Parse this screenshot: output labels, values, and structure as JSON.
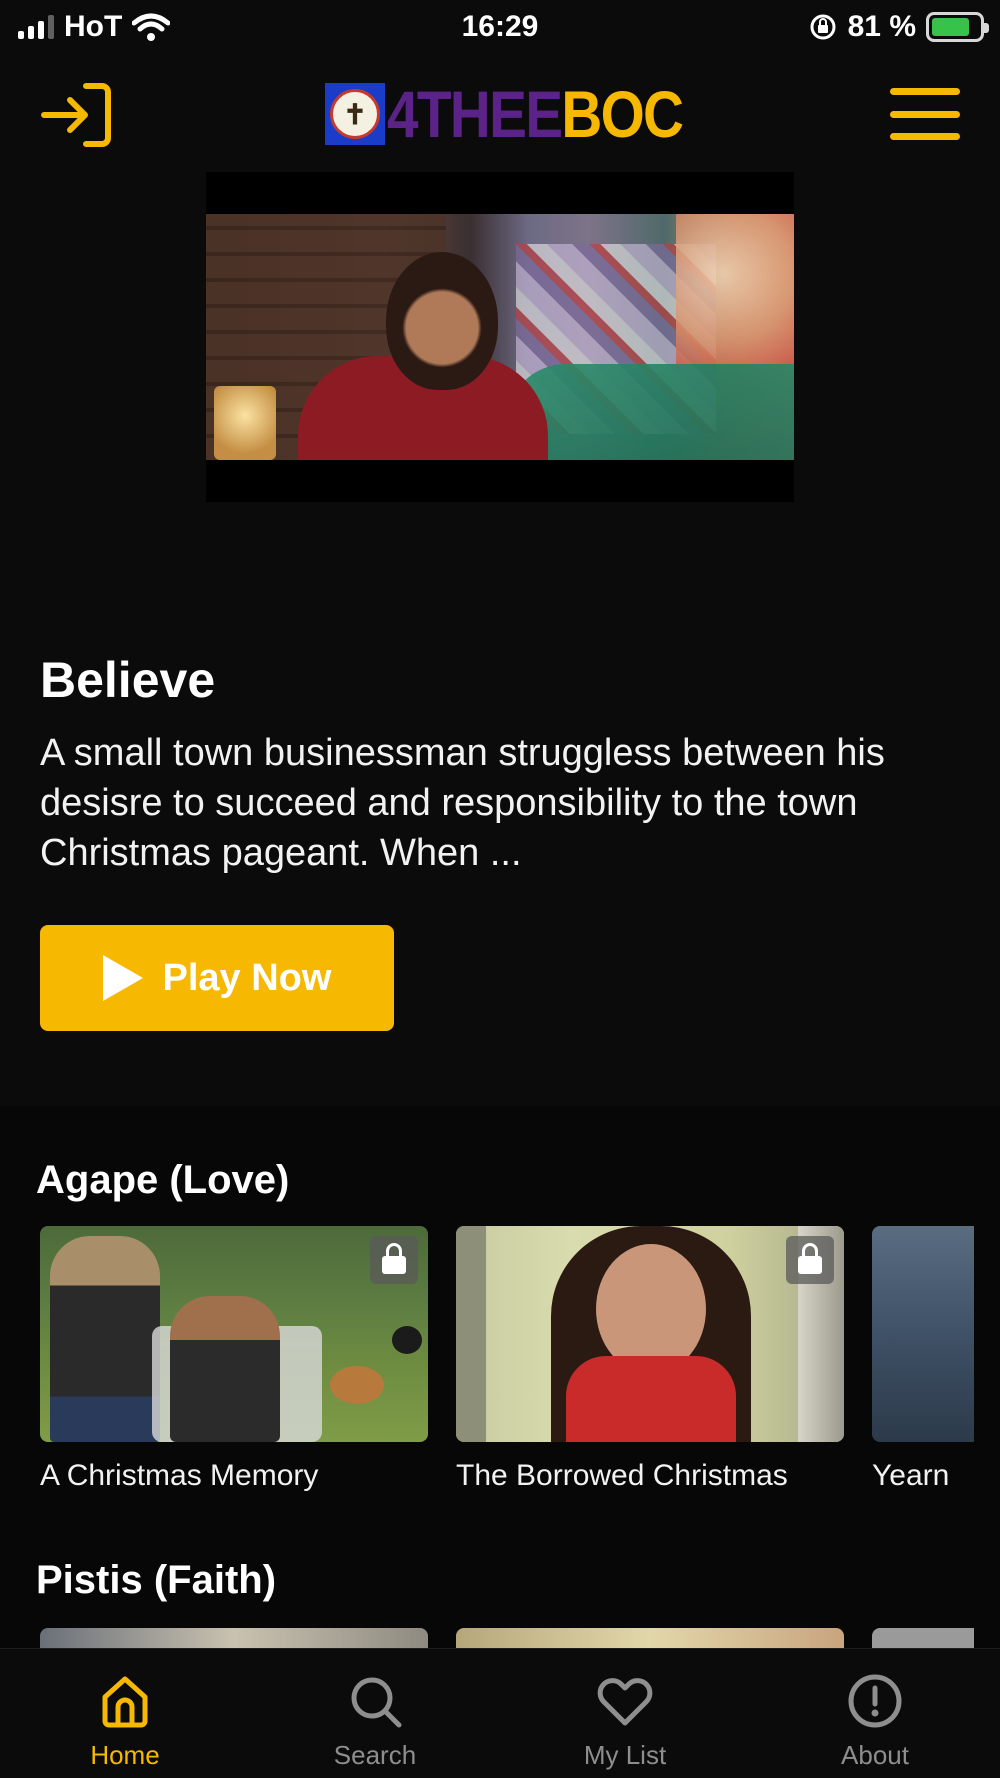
{
  "status_bar": {
    "carrier": "HoT",
    "time": "16:29",
    "battery_percent": "81 %",
    "battery_level": 0.81
  },
  "header": {
    "logo_part1": "4THEE",
    "logo_part2": "BOC",
    "login_icon": "login-icon",
    "menu_icon": "hamburger-menu-icon"
  },
  "hero": {
    "title": "Believe",
    "description": "A small town businessman struggless between his desisre to succeed and responsibility to the town Christmas pageant.  When ...",
    "play_label": "Play Now"
  },
  "rows": [
    {
      "title": "Agape (Love)",
      "items": [
        {
          "label": "A Christmas Memory",
          "locked": true
        },
        {
          "label": "The Borrowed Christmas",
          "locked": true
        },
        {
          "label": "Yearn",
          "locked": false
        }
      ]
    },
    {
      "title": "Pistis (Faith)",
      "items": []
    }
  ],
  "bottom_nav": {
    "items": [
      {
        "label": "Home",
        "icon": "home-icon",
        "active": true
      },
      {
        "label": "Search",
        "icon": "search-icon",
        "active": false
      },
      {
        "label": "My List",
        "icon": "heart-icon",
        "active": false
      },
      {
        "label": "About",
        "icon": "info-icon",
        "active": false
      }
    ]
  },
  "colors": {
    "accent": "#f6b800",
    "brand_purple": "#5b2287",
    "background": "#0b0b0b"
  }
}
